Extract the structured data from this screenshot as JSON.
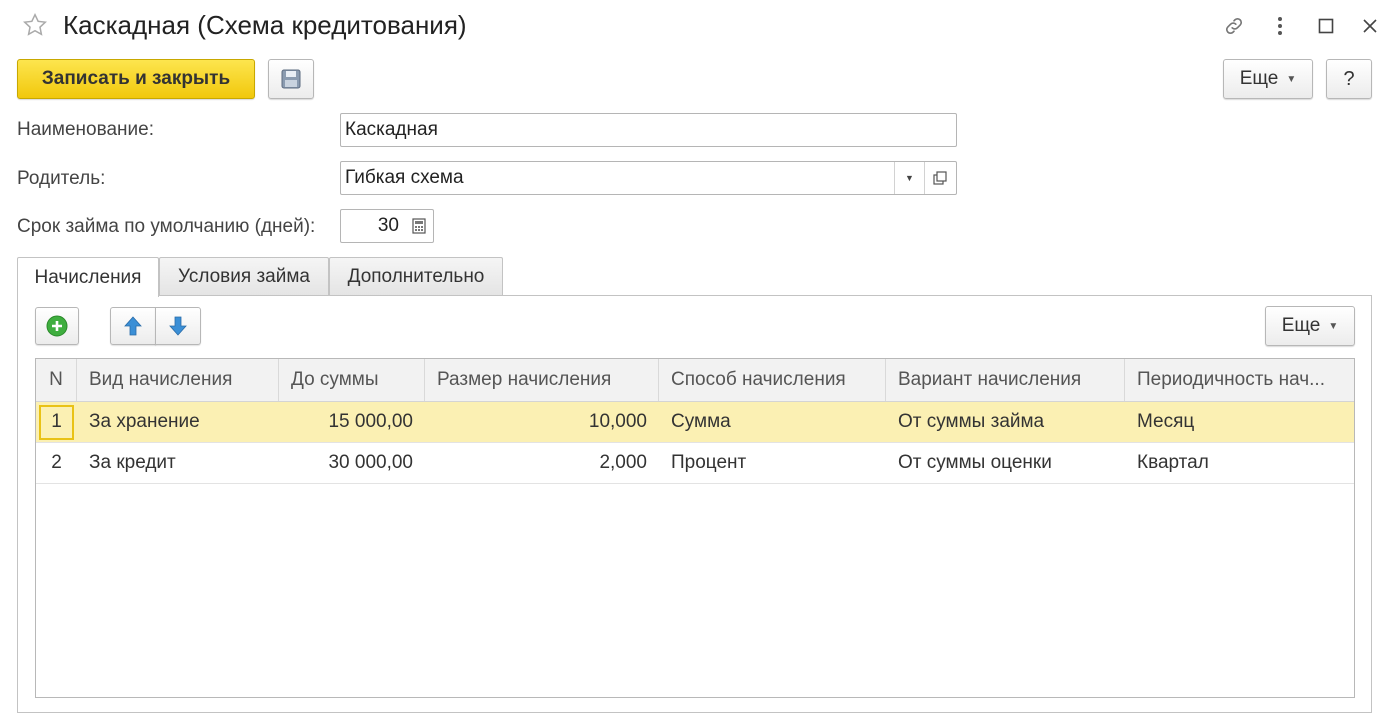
{
  "window": {
    "title": "Каскадная (Схема кредитования)",
    "icons": [
      "star-icon",
      "link-icon",
      "more-vertical-icon",
      "maximize-icon",
      "close-icon"
    ]
  },
  "toolbar": {
    "save_close_label": "Записать и закрыть",
    "more_label": "Еще",
    "help_label": "?"
  },
  "form": {
    "name_label": "Наименование:",
    "name_value": "Каскадная",
    "parent_label": "Родитель:",
    "parent_value": "Гибкая схема",
    "term_label": "Срок займа по умолчанию (дней):",
    "term_value": "30"
  },
  "tabs": [
    {
      "label": "Начисления",
      "active": true
    },
    {
      "label": "Условия займа",
      "active": false
    },
    {
      "label": "Дополнительно",
      "active": false
    }
  ],
  "table_toolbar": {
    "more_label": "Еще"
  },
  "table": {
    "columns": [
      "N",
      "Вид начисления",
      "До суммы",
      "Размер начисления",
      "Способ начисления",
      "Вариант начисления",
      "Периодичность нач..."
    ],
    "rows": [
      {
        "n": "1",
        "kind": "За хранение",
        "to_sum": "15 000,00",
        "size": "10,000",
        "method": "Сумма",
        "variant": "От суммы займа",
        "period": "Месяц",
        "selected": true
      },
      {
        "n": "2",
        "kind": "За кредит",
        "to_sum": "30 000,00",
        "size": "2,000",
        "method": "Процент",
        "variant": "От суммы оценки",
        "period": "Квартал",
        "selected": false
      }
    ]
  },
  "colors": {
    "primary_button": "#f5cf1f",
    "selected_row": "#fbf0b3",
    "add_icon": "#3fae3f",
    "arrow_icon": "#3b8fd6"
  }
}
